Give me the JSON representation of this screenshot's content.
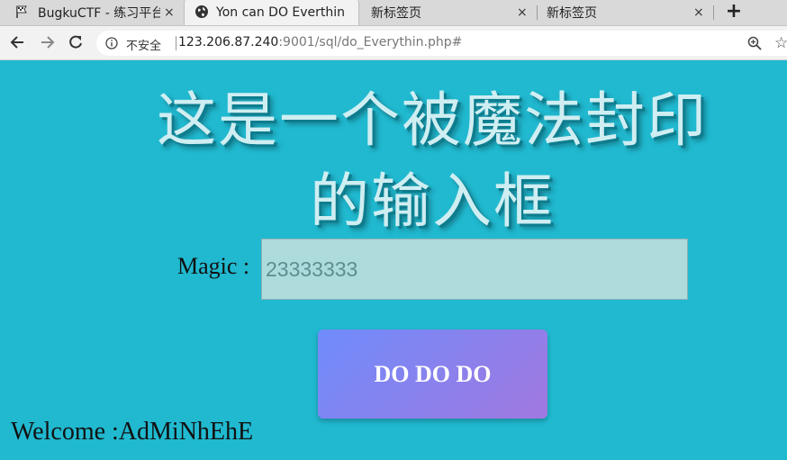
{
  "browser": {
    "tabs": [
      {
        "title": "BugkuCTF - 练习平台",
        "icon": "flag-icon",
        "active": false
      },
      {
        "title": "Yon can DO Everthin",
        "icon": "globe-icon",
        "active": true
      },
      {
        "title": "新标签页",
        "icon": "",
        "active": false
      },
      {
        "title": "新标签页",
        "icon": "",
        "active": false
      }
    ],
    "new_tab_label": "+",
    "close_glyph": "×",
    "security_label": "不安全",
    "url_host": "123.206.87.240",
    "url_rest": ":9001/sql/do_Everythin.php#"
  },
  "page": {
    "headline": "这是一个被魔法封印的输入框",
    "magic_label": "Magic :",
    "magic_placeholder": "23333333",
    "button_label": "DO DO DO",
    "welcome": "Welcome :AdMiNhEhE"
  },
  "colors": {
    "background": "#20b9d0",
    "input_bg": "#aedcdd",
    "button_gradient_start": "#6f8cfb",
    "button_gradient_end": "#a178e0"
  }
}
